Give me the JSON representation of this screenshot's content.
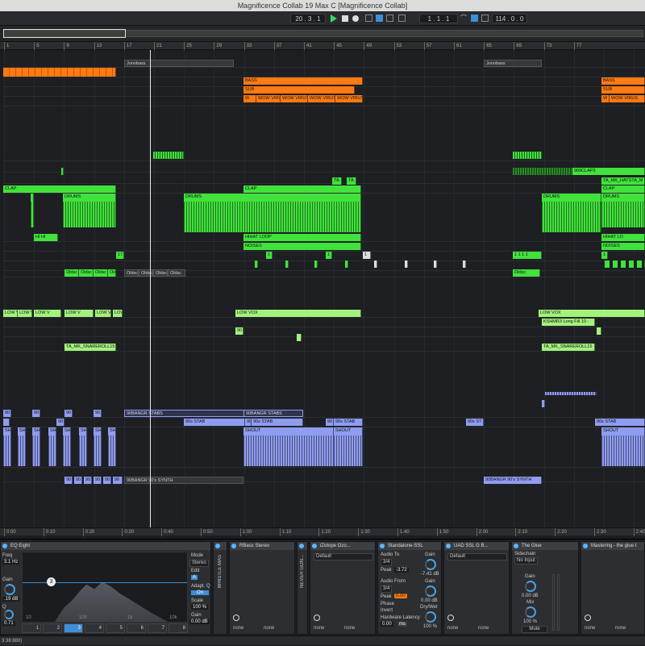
{
  "window": {
    "title": "Magnificence Collab 19 Max C  [Magnificence Collab]"
  },
  "transport": {
    "position": "20 .  3 .  1",
    "loop_start": "1 .  1 .  1",
    "tempo": "114 .  0 .  0"
  },
  "ruler": {
    "bars": [
      "1",
      "5",
      "9",
      "13",
      "17",
      "21",
      "25",
      "29",
      "33",
      "37",
      "41",
      "45",
      "49",
      "53",
      "57",
      "61",
      "65",
      "69",
      "73",
      "77"
    ]
  },
  "timeline": {
    "times": [
      "0:00",
      "0:10",
      "0:20",
      "0:30",
      "0:40",
      "0:50",
      "1:00",
      "1:10",
      "1:20",
      "1:30",
      "1:40",
      "1:50",
      "2:00",
      "2:10",
      "2:20",
      "2:30",
      "2:40"
    ]
  },
  "clips": {
    "junobass": "Junobass",
    "junobass2": "Junobass",
    "bass": "BASS",
    "sub": "SUB",
    "wow": "WOW VIRUS",
    "w": "W",
    "bass2": "BASS",
    "sub2": "SUB",
    "wow2": "WOW VIRUS",
    "w2": "W",
    "clap": "CLAP",
    "clap2": "CLAP",
    "clap3": "CLAP",
    "drums": "DRUMS",
    "drums2": "DRUMS",
    "drums3": "DRUMS",
    "drums4": "DRUMS",
    "ta": "TA",
    "hihat": "HIHAT LOOP",
    "noises": "NOISES",
    "hi": "HI HI",
    "clap909": "909CLAP3",
    "ta_hat": "TA_MK_HATSTA_M",
    "noises2": "NOISES",
    "hihat2": "HIHAT LO",
    "oldsc": "Oldsc",
    "oldsc2": "Oldsc",
    "olds3": "Olds",
    "low_v": "LOW V",
    "low_vox": "LOW VOX",
    "low_vox2": "LOW VOX",
    "n90": "90",
    "kshmr": "KSHMR3 Long Fill 10 -",
    "snare": "TA_MK_SNAREROLL15",
    "snare2": "TA_MK_SNAREROLL15",
    "stabs": "90BANGR STABS",
    "stabs2": "90BANGR STABS",
    "stab90": "90s STAB",
    "stab90b": "90s STAB",
    "s90": "90",
    "s90b": "90s ST",
    "s90c": "90s STAB",
    "shout": "SHOUT",
    "shout2": "SHOUT",
    "shout3": "SHOUT",
    "sh": "SH",
    "synth": "90BANGR 90's SYNTH",
    "synth2": "90BANGR 90's SYNTH",
    "n9": "90"
  },
  "devices": {
    "eq": {
      "title": "EQ Eight",
      "freq_label": "Freq",
      "freq_val": "3.1 Hz",
      "gain_label": "Gain",
      "gain_val": ".19 dB",
      "q_label": "Q",
      "q_val": "0.71",
      "mode_label": "Mode",
      "mode_val": "Stereo",
      "edit_label": "Edit",
      "edit_val": "A",
      "adapt_label": "Adapt. Q",
      "adapt_val": "On",
      "scale_label": "Scale",
      "scale_val": "100 %",
      "gain2_label": "Gain",
      "gain2_val": "0.00 dB",
      "node": "3",
      "bands": [
        "1",
        "2",
        "3",
        "4",
        "5",
        "6",
        "7",
        "8"
      ],
      "scale_ticks": [
        "10",
        "100",
        "1k",
        "10k"
      ]
    },
    "whistle": {
      "name": "WHISTLE MAS"
    },
    "rbass": {
      "title": "RBass Stereo",
      "slot": "none"
    },
    "never": {
      "name": "NEVER GON..."
    },
    "izotope": {
      "title": "iZotope Ozo...",
      "preset": "Default",
      "slot": "none"
    },
    "ssl": {
      "title": "Standalone-SSL",
      "audio_to": "Audio To",
      "at_val": "3/4",
      "peak_label": "Peak",
      "peak_val": "-3.72",
      "audio_from": "Audio From",
      "af_val": "3/4",
      "peak2_val": "0.00",
      "phase_label": "Phase",
      "invert": "Invert",
      "latency_label": "Hardware Latency",
      "latency_val": "0.00",
      "ms": "ms",
      "gain_label": "Gain",
      "gain_val": "-7.41 dB",
      "gain2_label": "Gain",
      "gain2_val": "0.00 dB",
      "drywet_label": "Dry/Wet",
      "drywet_val": "100 %"
    },
    "uad": {
      "title": "UAD SSL G B...",
      "preset": "Default",
      "slot": "none"
    },
    "glue": {
      "title": "The Glue",
      "sidechain": "Sidechain",
      "no_input": "No Input",
      "gain_label": "Gain",
      "gain_val": "0.00 dB",
      "mix_label": "Mix",
      "mix_val": "100 %",
      "mute": "Mute",
      "slot": "none"
    },
    "mastering": {
      "title": "Mastering - the glue t",
      "slot": "none"
    }
  },
  "status": {
    "text": "3:38:880)"
  }
}
